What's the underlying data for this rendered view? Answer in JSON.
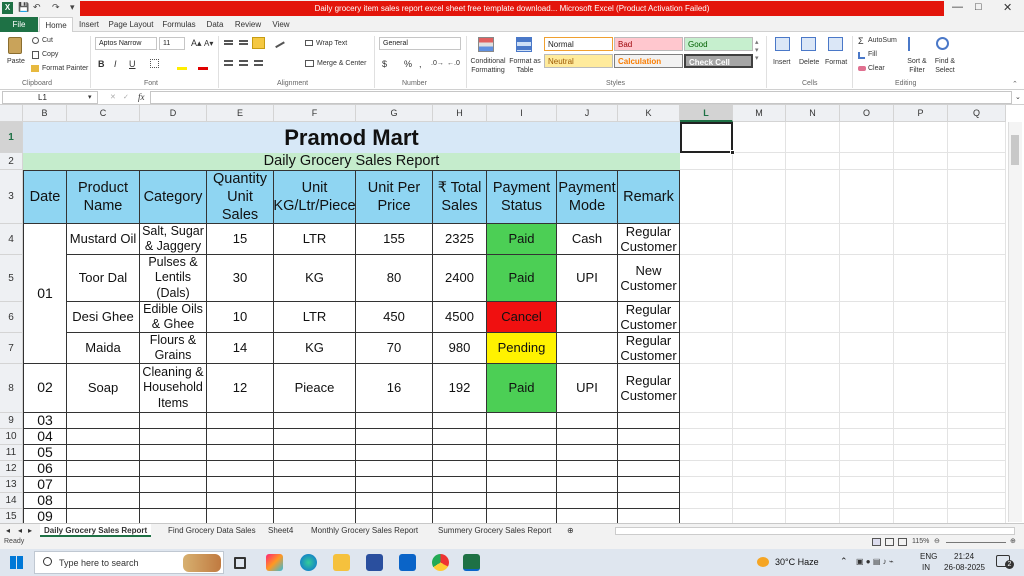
{
  "window": {
    "title": "Daily grocery item sales report excel sheet free template download... Microsoft Excel (Product Activation Failed)",
    "minimize": "—",
    "restore": "□",
    "close": "✕",
    "quick_access": [
      "💾",
      "↶",
      "↷",
      "▾"
    ]
  },
  "ribbon_tabs": [
    "File",
    "Home",
    "Insert",
    "Page Layout",
    "Formulas",
    "Data",
    "Review",
    "View"
  ],
  "ribbon": {
    "paste": "Paste",
    "cut": "Cut",
    "copy": "Copy",
    "format_painter": "Format Painter",
    "font_name": "Aptos Narrow",
    "font_size": "11",
    "wrap_text": "Wrap Text",
    "merge_center": "Merge & Center",
    "number_format": "General",
    "conditional_formatting": "Conditional Formatting",
    "format_as_table": "Format as Table",
    "insert": "Insert",
    "delete": "Delete",
    "format": "Format",
    "autosum": "AutoSum",
    "fill": "Fill",
    "clear": "Clear",
    "sort_filter": "Sort & Filter",
    "find_select": "Find & Select",
    "bold": "B",
    "italic": "I",
    "underline": "U",
    "percent": "%",
    "comma": ",",
    "currency": "$",
    "styles": [
      {
        "label": "Normal",
        "bg": "#ffffff",
        "fg": "#000000"
      },
      {
        "label": "Bad",
        "bg": "#ffc7ce",
        "fg": "#9c0006"
      },
      {
        "label": "Good",
        "bg": "#c6efce",
        "fg": "#006100"
      },
      {
        "label": "Neutral",
        "bg": "#ffeb9c",
        "fg": "#9c5700"
      },
      {
        "label": "Calculation",
        "bg": "#f2f2f2",
        "fg": "#fa7d00"
      },
      {
        "label": "Check Cell",
        "bg": "#a5a5a5",
        "fg": "#ffffff"
      }
    ],
    "groups": [
      "Clipboard",
      "Font",
      "Alignment",
      "Number",
      "Styles",
      "Cells",
      "Editing"
    ]
  },
  "formula_bar": {
    "name_box": "L1",
    "fx": "fx",
    "value": ""
  },
  "columns": [
    "B",
    "C",
    "D",
    "E",
    "F",
    "G",
    "H",
    "I",
    "J",
    "K",
    "L",
    "M",
    "N",
    "O",
    "P",
    "Q"
  ],
  "rows": [
    "1",
    "2",
    "3",
    "4",
    "5",
    "6",
    "7",
    "8",
    "9",
    "10",
    "11",
    "12",
    "13",
    "14",
    "15"
  ],
  "sheet": {
    "title": "Pramod Mart",
    "subtitle": "Daily Grocery Sales Report",
    "headers": [
      "Date",
      "Product Name",
      "Category",
      "Quantity Unit Sales",
      "Unit KG/Ltr/Piece",
      "Unit Per Price",
      "₹ Total Sales",
      "Payment Status",
      "Payment Mode",
      "Remark"
    ],
    "date_groups": [
      "01",
      "02",
      "03",
      "04",
      "05",
      "06",
      "07",
      "08",
      "09"
    ],
    "records": [
      {
        "product": "Mustard Oil",
        "category": "Salt, Sugar & Jaggery",
        "qty": "15",
        "unit": "LTR",
        "price": "155",
        "total": "2325",
        "status": "Paid",
        "mode": "Cash",
        "remark": "Regular Customer"
      },
      {
        "product": "Toor Dal",
        "category": "Pulses & Lentils (Dals)",
        "qty": "30",
        "unit": "KG",
        "price": "80",
        "total": "2400",
        "status": "Paid",
        "mode": "UPI",
        "remark": "New Customer"
      },
      {
        "product": "Desi Ghee",
        "category": "Edible Oils & Ghee",
        "qty": "10",
        "unit": "LTR",
        "price": "450",
        "total": "4500",
        "status": "Cancel",
        "mode": "",
        "remark": "Regular Customer"
      },
      {
        "product": "Maida",
        "category": "Flours & Grains",
        "qty": "14",
        "unit": "KG",
        "price": "70",
        "total": "980",
        "status": "Pending",
        "mode": "",
        "remark": "Regular Customer"
      },
      {
        "product": "Soap",
        "category": "Cleaning & Household Items",
        "qty": "12",
        "unit": "Pieace",
        "price": "16",
        "total": "192",
        "status": "Paid",
        "mode": "UPI",
        "remark": "Regular Customer"
      }
    ],
    "status_colors": {
      "Paid": "#4ccf55",
      "Cancel": "#f01010",
      "Pending": "#fff200"
    }
  },
  "sheet_tabs": [
    "Daily Grocery Sales Report",
    "Find Grocery Data Sales",
    "Sheet4",
    "Monthly Grocery Sales Report",
    "Summery Grocery Sales Report"
  ],
  "status_bar": {
    "ready": "Ready",
    "zoom": "115%"
  },
  "taskbar": {
    "search_placeholder": "Type here to search",
    "weather": "30°C  Haze",
    "lang": "ENG",
    "lang2": "IN",
    "time": "21:24",
    "date": "26-08-2025",
    "notif": "2"
  }
}
